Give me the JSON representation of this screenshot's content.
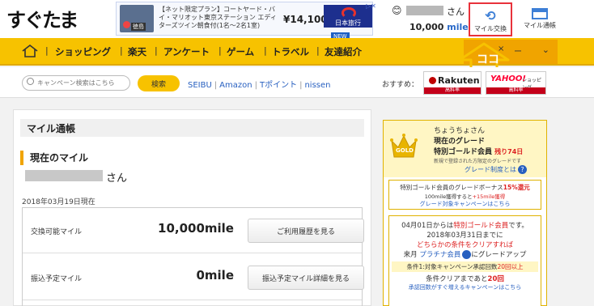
{
  "header": {
    "logo": "すぐたま",
    "ad": {
      "text": "【ネット限定プラン】コートヤード・バイ・マリオット東京ステーション エディターズツイン朝食付(1名～2名1室)",
      "hotel_badge": "徳島",
      "price": "¥14,100～",
      "advertiser": "日本旅行",
      "new_label": "NEW",
      "close_icon": "info-close-icon"
    },
    "user": {
      "suffix": "さん",
      "mile_value": "10,000",
      "mile_unit": "mile"
    },
    "exchange_button": {
      "label": "マイル交換",
      "icon": "refresh-icon"
    },
    "passbook_button": {
      "label": "マイル通帳",
      "icon": "passbook-icon"
    }
  },
  "nav": {
    "items": [
      "ショッピング",
      "楽天",
      "アンケート",
      "ゲーム",
      "トラベル",
      "友達紹介"
    ],
    "right_close": "×",
    "right_dash": "ー",
    "right_chevron": "⌄"
  },
  "annotation": {
    "text": "ココ",
    "color": "#f7c200"
  },
  "search": {
    "placeholder": "キャンペーン検索はこちら",
    "button": "検索",
    "links": [
      "SEIBU",
      "Amazon",
      "Tポイント",
      "nissen"
    ],
    "recommend_label": "おすすめ：",
    "rakuten": {
      "name": "Rakuten",
      "rate": "高料率"
    },
    "yahoo": {
      "name": "YAHOO!",
      "sub": "ショッピング",
      "rate": "高料率"
    }
  },
  "main": {
    "title": "マイル通帳",
    "current_heading": "現在のマイル",
    "name_suffix": "さん",
    "date": "2018年03月19日現在",
    "rows": [
      {
        "label": "交換可能マイル",
        "value": "10,000mile",
        "button": "ご利用履歴を見る"
      },
      {
        "label": "振込予定マイル",
        "value": "0mile",
        "button": "振込予定マイル詳細を見る"
      }
    ]
  },
  "grade": {
    "username": "ちょうちょさん",
    "current_label": "現在のグレード",
    "grade_name": "特別ゴールド会員",
    "remaining": "残り74日",
    "note": "新規で登録された方限定のグレードです",
    "badge": "GOLD",
    "link": "グレード制度とは",
    "bonus_line1_pre": "特別ゴールド会員のグレードボーナス",
    "bonus_line1_pct": "15%還元",
    "bonus_line2_pre": "100mile獲得すると",
    "bonus_line2_bonus": "+15mile獲得",
    "bonus_link": "グレード対象キャンペーンはこちら",
    "plat_line1_pre": "04月01日からは",
    "plat_line1_red": "特別ゴールド会員",
    "plat_line1_post": "です。",
    "plat_line2": "2018年03月31日までに",
    "plat_line3": "どちらかの条件をクリアすれば",
    "plat_line4_pre": "来月",
    "plat_line4_link": "プラチナ会員",
    "plat_line4_post": "にグレードアップ",
    "cond_pre": "条件1:対象キャンペーン承認回数",
    "cond_red": "20回以上",
    "clear_pre": "条件クリアまであと",
    "clear_red": "20回",
    "campaign_link": "承認回数がすぐ増えるキャンペーンはこちら"
  }
}
